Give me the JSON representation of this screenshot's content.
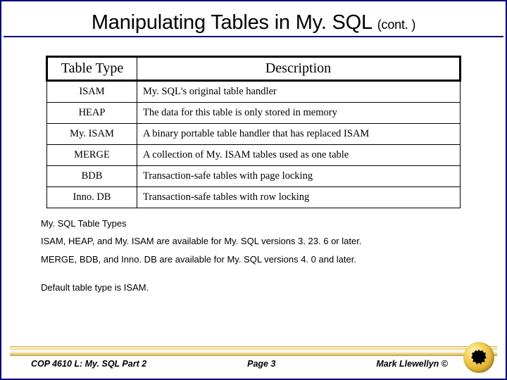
{
  "title": {
    "main": "Manipulating Tables in My. SQL",
    "cont": "(cont. )"
  },
  "table": {
    "headers": {
      "type": "Table Type",
      "desc": "Description"
    },
    "rows": [
      {
        "type": "ISAM",
        "desc": "My. SQL's original table handler"
      },
      {
        "type": "HEAP",
        "desc": "The data for this table is only stored in memory"
      },
      {
        "type": "My. ISAM",
        "desc": "A binary portable table handler that has replaced ISAM"
      },
      {
        "type": "MERGE",
        "desc": "A collection of My. ISAM tables used as one table"
      },
      {
        "type": "BDB",
        "desc": "Transaction-safe tables with page locking"
      },
      {
        "type": "Inno. DB",
        "desc": "Transaction-safe tables with row locking"
      }
    ]
  },
  "notes": {
    "heading": "My. SQL Table Types",
    "line1": "ISAM, HEAP, and My. ISAM are available for My. SQL versions 3. 23. 6 or later.",
    "line2": "MERGE, BDB, and Inno. DB are available for My. SQL versions 4. 0 and later.",
    "line3": "Default table type is ISAM."
  },
  "footer": {
    "left": "COP 4610 L: My. SQL Part 2",
    "center": "Page 3",
    "right": "Mark Llewellyn ©"
  }
}
